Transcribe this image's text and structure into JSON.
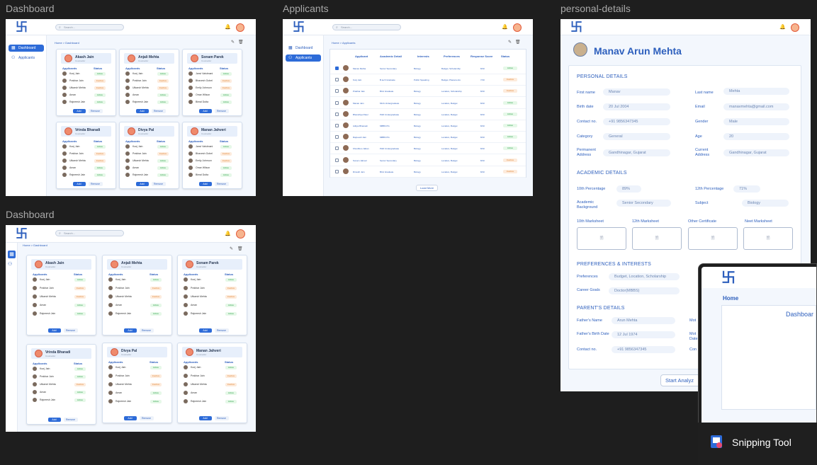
{
  "canvas": {
    "frame_labels": [
      "Dashboard",
      "Applicants",
      "personal-details",
      "Dashboard"
    ]
  },
  "common": {
    "logo_glyph": "卐",
    "search_placeholder": "Search...",
    "bell": "bell-icon",
    "avatar": "user-avatar",
    "breadcrumb_dash": "Home > Dashboard",
    "breadcrumb_app": "Home > Applicants",
    "brand_color": "#2d6bd8"
  },
  "sidebar": {
    "dashboard": "Dashboard",
    "applicants": "Applicants"
  },
  "cards": [
    {
      "name": "Akash Jain",
      "sub": "Counsellor",
      "add": "Add",
      "remove": "Remove"
    },
    {
      "name": "Anjali Mehta",
      "sub": "Counsellor",
      "add": "Add",
      "remove": "Remove"
    },
    {
      "name": "Sonam Parek",
      "sub": "Counsellor",
      "add": "Add",
      "remove": "Remove"
    },
    {
      "name": "Vrinda Bharadi",
      "sub": "Counsellor",
      "add": "Add",
      "remove": "Remove"
    },
    {
      "name": "Divya Pal",
      "sub": "Counsellor",
      "add": "Add",
      "remove": "Remove"
    },
    {
      "name": "Manan Jahveri",
      "sub": "Counsellor",
      "add": "Add",
      "remove": "Remove"
    }
  ],
  "card_cols": {
    "applicants": "Applicants",
    "status": "Status"
  },
  "card_rows": [
    [
      {
        "n": "Kunj Jain",
        "s": "Active",
        "t": "a"
      },
      {
        "n": "Prakhar Jain",
        "s": "Inactive",
        "t": "i"
      },
      {
        "n": "Utkarsh Mehta",
        "s": "Inactive",
        "t": "i"
      },
      {
        "n": "Aman",
        "s": "Active",
        "t": "a"
      },
      {
        "n": "Rajneesh Jain",
        "s": "Active",
        "t": "a"
      }
    ],
    [
      {
        "n": "Kunj Jain",
        "s": "Active",
        "t": "a"
      },
      {
        "n": "Prakhar Jain",
        "s": "Inactive",
        "t": "i"
      },
      {
        "n": "Utkarsh Mehta",
        "s": "Inactive",
        "t": "i"
      },
      {
        "n": "Aman",
        "s": "Active",
        "t": "a"
      },
      {
        "n": "Rajneesh Jain",
        "s": "Active",
        "t": "a"
      }
    ],
    [
      {
        "n": "Janvi Vaishnani",
        "s": "Active",
        "t": "a"
      },
      {
        "n": "Bhavesh Gohel",
        "s": "Inactive",
        "t": "i"
      },
      {
        "n": "Emily Johnson",
        "s": "Inactive",
        "t": "i"
      },
      {
        "n": "Omar Wilson",
        "s": "Active",
        "t": "a"
      },
      {
        "n": "Bimal Dutta",
        "s": "Active",
        "t": "a"
      }
    ],
    [
      {
        "n": "Kunj Jain",
        "s": "Active",
        "t": "a"
      },
      {
        "n": "Prakhar Jain",
        "s": "Inactive",
        "t": "i"
      },
      {
        "n": "Utkarsh Mehta",
        "s": "Inactive",
        "t": "i"
      },
      {
        "n": "Aman",
        "s": "Active",
        "t": "a"
      },
      {
        "n": "Rajneesh Jain",
        "s": "Active",
        "t": "a"
      }
    ],
    [
      {
        "n": "Kunj Jain",
        "s": "Active",
        "t": "a"
      },
      {
        "n": "Prakhar Jain",
        "s": "Inactive",
        "t": "i"
      },
      {
        "n": "Utkarsh Mehta",
        "s": "Active",
        "t": "a"
      },
      {
        "n": "Aman",
        "s": "Active",
        "t": "a"
      },
      {
        "n": "Rajneesh Jain",
        "s": "Active",
        "t": "a"
      }
    ],
    [
      {
        "n": "Janvi Vaishnani",
        "s": "Active",
        "t": "a"
      },
      {
        "n": "Bhavesh Gohel",
        "s": "Inactive",
        "t": "i"
      },
      {
        "n": "Emily Johnson",
        "s": "Inactive",
        "t": "i"
      },
      {
        "n": "Omar Wilson",
        "s": "Active",
        "t": "a"
      },
      {
        "n": "Bimal Dutta",
        "s": "Active",
        "t": "a"
      }
    ]
  ],
  "card_rows_b": [
    [
      {
        "n": "Kunj Jain",
        "s": "Active",
        "t": "a"
      },
      {
        "n": "Prakhar Jain",
        "s": "Inactive",
        "t": "i"
      },
      {
        "n": "Utkarsh Mehta",
        "s": "Inactive",
        "t": "i"
      },
      {
        "n": "Aman",
        "s": "Active",
        "t": "a"
      },
      {
        "n": "Rajneesh Jain",
        "s": "Active",
        "t": "a"
      }
    ],
    [
      {
        "n": "Kunj Jain",
        "s": "Active",
        "t": "a"
      },
      {
        "n": "Prakhar Jain",
        "s": "Inactive",
        "t": "i"
      },
      {
        "n": "Utkarsh Mehta",
        "s": "Inactive",
        "t": "i"
      },
      {
        "n": "Aman",
        "s": "Active",
        "t": "a"
      },
      {
        "n": "Rajneesh Jain",
        "s": "Active",
        "t": "a"
      }
    ],
    [
      {
        "n": "Kunj Jain",
        "s": "Active",
        "t": "a"
      },
      {
        "n": "Prakhar Jain",
        "s": "Inactive",
        "t": "i"
      },
      {
        "n": "Utkarsh Mehta",
        "s": "Inactive",
        "t": "i"
      },
      {
        "n": "Aman",
        "s": "Active",
        "t": "a"
      },
      {
        "n": "Rajneesh Jain",
        "s": "Active",
        "t": "a"
      }
    ],
    [
      {
        "n": "Kunj Jain",
        "s": "Active",
        "t": "a"
      },
      {
        "n": "Prakhar Jain",
        "s": "Active",
        "t": "a"
      },
      {
        "n": "Utkarsh Mehta",
        "s": "Inactive",
        "t": "i"
      },
      {
        "n": "Aman",
        "s": "Active",
        "t": "a"
      },
      {
        "n": "Rajneesh Jain",
        "s": "Active",
        "t": "a"
      }
    ],
    [
      {
        "n": "Kunj Jain",
        "s": "Active",
        "t": "a"
      },
      {
        "n": "Prakhar Jain",
        "s": "Inactive",
        "t": "i"
      },
      {
        "n": "Utkarsh Mehta",
        "s": "Inactive",
        "t": "i"
      },
      {
        "n": "Aman",
        "s": "Active",
        "t": "a"
      },
      {
        "n": "Rajneesh Jain",
        "s": "Active",
        "t": "a"
      }
    ],
    [
      {
        "n": "Kunj Jain",
        "s": "Active",
        "t": "a"
      },
      {
        "n": "Prakhar Jain",
        "s": "Inactive",
        "t": "i"
      },
      {
        "n": "Utkarsh Mehta",
        "s": "Inactive",
        "t": "i"
      },
      {
        "n": "Aman",
        "s": "Active",
        "t": "a"
      },
      {
        "n": "Rajneesh Jain",
        "s": "Active",
        "t": "a"
      }
    ]
  ],
  "applicants_table": {
    "headers": [
      "Applicant",
      "Academic Detail",
      "Interests",
      "Preferences",
      "Response Score",
      "Status"
    ],
    "rows": [
      {
        "name": "Manav Mehta",
        "acad": "Senior Secondary",
        "int": "Biology",
        "pref": "Budget, Scholarship",
        "score": "8/10",
        "status": "Active",
        "t": "a",
        "checked": true
      },
      {
        "name": "Kunj Jain",
        "acad": "B.tech Graduate",
        "int": "Public Speaking",
        "pref": "Budget, Placements",
        "score": "7/10",
        "status": "Inactive",
        "t": "i",
        "checked": false
      },
      {
        "name": "Prakhar Jain",
        "acad": "BCA Graduate",
        "int": "Biology",
        "pref": "Location, Scholarship",
        "score": "8/10",
        "status": "Inactive",
        "t": "i",
        "checked": false
      },
      {
        "name": "Manan Jain",
        "acad": "MCA Undergraduate",
        "int": "Biology",
        "pref": "Location, Budget",
        "score": "8/10",
        "status": "Active",
        "t": "a",
        "checked": false
      },
      {
        "name": "Bhavishya Patel",
        "acad": "PHD Undergraduate",
        "int": "Biology",
        "pref": "Location, Budget",
        "score": "8/10",
        "status": "Active",
        "t": "a",
        "checked": false
      },
      {
        "name": "Aditya Bhansali",
        "acad": "MBBS PG",
        "int": "Biology",
        "pref": "Location, Budget",
        "score": "8/10",
        "status": "Active",
        "t": "a",
        "checked": false
      },
      {
        "name": "Rajneesh Jain",
        "acad": "MBBS PG",
        "int": "Biology",
        "pref": "Location, Budget",
        "score": "8/10",
        "status": "Active",
        "t": "a",
        "checked": false
      },
      {
        "name": "Khushboo Jahan",
        "acad": "PHD Undergraduate",
        "int": "Biology",
        "pref": "Location, Budget",
        "score": "8/10",
        "status": "Active",
        "t": "a",
        "checked": false
      },
      {
        "name": "Sonam Jahveri",
        "acad": "Senior Secondary",
        "int": "Biology",
        "pref": "Location, Budget",
        "score": "8/10",
        "status": "Inactive",
        "t": "i",
        "checked": false
      },
      {
        "name": "Rinsuth Jain",
        "acad": "BCA Graduate",
        "int": "Biology",
        "pref": "Location, Budget",
        "score": "8/10",
        "status": "Inactive",
        "t": "i",
        "checked": false
      }
    ],
    "load_more": "Load More"
  },
  "personal": {
    "name": "Manav Arun Mehta",
    "sec_personal": "PERSONAL DETAILS",
    "sec_academic": "ACADEMIC DETAILS",
    "sec_pref": "PREFERENCES & INTERESTS",
    "sec_parent": "PARENT'S DETAILS",
    "first_name_l": "First name",
    "first_name_v": "Manav",
    "last_name_l": "Last name",
    "last_name_v": "Mehta",
    "birth_l": "Birth date",
    "birth_v": "20 Jul 2004",
    "email_l": "Email",
    "email_v": "manavmehta@gmail.com",
    "contact_l": "Contact no.",
    "contact_v": "+91 9856347345",
    "gender_l": "Gender",
    "gender_v": "Male",
    "category_l": "Category",
    "category_v": "General",
    "age_l": "Age",
    "age_v": "20",
    "perm_l": "Permanent Address",
    "perm_v": "Gandhinagar, Gujarat",
    "curr_l": "Current Address",
    "curr_v": "Gandhinagar, Gujarat",
    "p10_l": "10th Percentage",
    "p10_v": "89%",
    "p12_l": "12th Percentage",
    "p12_v": "71%",
    "acadbg_l": "Academic Background",
    "acadbg_v": "Senior Secondary",
    "subject_l": "Subject",
    "subject_v": "Biology",
    "ms10": "10th  Marksheet",
    "ms12": "12th Marksheet",
    "msother": "Other Certificate",
    "msneet": "Neet  Marksheet",
    "prefs_l": "Preferences",
    "prefs_v": "Budget, Location, Scholarship",
    "goals_l": "Career Goals",
    "goals_v": "Doctor(MBBS)",
    "father_l": "Father's Name",
    "father_v": "Arun Mehta",
    "fbirth_l": "Father's Birth Date",
    "fbirth_v": "12 Jul 1974",
    "pcontact_l": "Contact no.",
    "pcontact_v": "+91 9856347345",
    "mo1": "Mot",
    "mo2": "Mot Date",
    "mo3": "Con",
    "start": "Start Analyz"
  },
  "overlay": {
    "home": "Home",
    "dash": "Dashboar"
  },
  "snip": {
    "label": "Snipping Tool"
  }
}
